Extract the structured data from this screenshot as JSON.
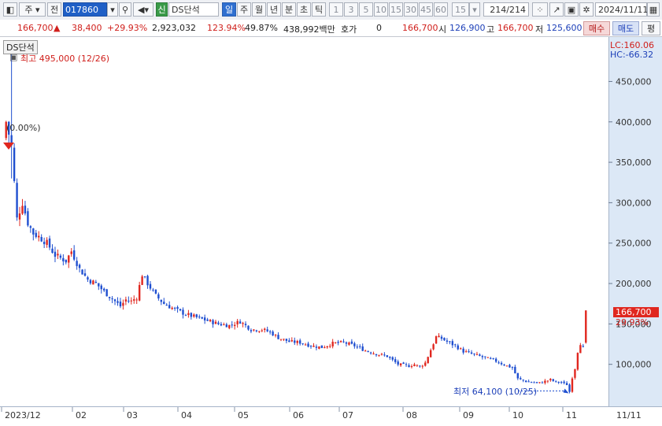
{
  "toolbar": {
    "period_prefix": "주",
    "prev_label": "전",
    "code": "017860",
    "badge": "신",
    "name": "DS단석",
    "periods": [
      "일",
      "주",
      "월",
      "년",
      "분",
      "초",
      "틱"
    ],
    "active_period": "일",
    "numbers": [
      "1",
      "3",
      "5",
      "10",
      "15",
      "30",
      "45",
      "60"
    ],
    "combo": "15",
    "count": "214",
    "count_total": "/214",
    "date": "2024/11/11"
  },
  "quote": {
    "price": "166,700",
    "change": "38,400",
    "change_pct": "+29.93%",
    "volume": "2,923,032",
    "vol_ratio": "123.94%",
    "rate2": "49.87%",
    "amount": "438,992백만",
    "hoga_label": "호가",
    "hoga_value": "0",
    "hoga_price": "166,700",
    "open_label": "시",
    "open": "126,900",
    "high_label": "고",
    "high": "166,700",
    "low_label": "저",
    "low": "125,600",
    "buy": "매수",
    "sell": "매도",
    "avg": "평"
  },
  "chart_labels": {
    "series_tag": "DS단석",
    "lc": "LC:160.06",
    "hc": "HC:-66.32",
    "start_marker": "(0.00%)",
    "max_note": "최고 495,000 (12/26)",
    "min_note": "최저 64,100 (10/25)",
    "last_price": "166,700",
    "last_pct": "29.93%"
  },
  "colors": {
    "up": "#e0271f",
    "down": "#1f4fd0",
    "panel": "#dce8f6"
  },
  "chart_data": {
    "type": "candlestick",
    "x_labels": [
      "2023/12",
      "02",
      "03",
      "04",
      "05",
      "06",
      "07",
      "08",
      "09",
      "10",
      "11",
      "11/11"
    ],
    "y_ticks": [
      100000,
      150000,
      200000,
      250000,
      300000,
      350000,
      400000,
      450000
    ],
    "y_tick_labels": [
      "100,000",
      "150,000",
      "200,000",
      "250,000",
      "300,000",
      "350,000",
      "400,000",
      "450,000"
    ],
    "ylim": [
      50000,
      505000
    ],
    "close_path": [
      [
        0,
        400000
      ],
      [
        2,
        370000
      ],
      [
        4,
        280000
      ],
      [
        6,
        300000
      ],
      [
        8,
        275000
      ],
      [
        10,
        262000
      ],
      [
        12,
        258000
      ],
      [
        15,
        250000
      ],
      [
        18,
        235000
      ],
      [
        22,
        228000
      ],
      [
        24,
        240000
      ],
      [
        27,
        218000
      ],
      [
        30,
        205000
      ],
      [
        33,
        200000
      ],
      [
        36,
        190000
      ],
      [
        40,
        178000
      ],
      [
        42,
        172000
      ],
      [
        44,
        180000
      ],
      [
        46,
        178000
      ],
      [
        48,
        183000
      ],
      [
        50,
        211000
      ],
      [
        52,
        200000
      ],
      [
        55,
        185000
      ],
      [
        58,
        175000
      ],
      [
        62,
        168000
      ],
      [
        66,
        162000
      ],
      [
        70,
        158000
      ],
      [
        74,
        154000
      ],
      [
        78,
        150000
      ],
      [
        82,
        148000
      ],
      [
        86,
        153000
      ],
      [
        88,
        148000
      ],
      [
        90,
        143000
      ],
      [
        94,
        143000
      ],
      [
        97,
        140000
      ],
      [
        100,
        133000
      ],
      [
        104,
        128000
      ],
      [
        108,
        127000
      ],
      [
        112,
        123000
      ],
      [
        116,
        121000
      ],
      [
        120,
        126000
      ],
      [
        124,
        127000
      ],
      [
        128,
        123000
      ],
      [
        132,
        117000
      ],
      [
        136,
        113000
      ],
      [
        140,
        110000
      ],
      [
        144,
        100000
      ],
      [
        148,
        98000
      ],
      [
        150,
        100000
      ],
      [
        152,
        97000
      ],
      [
        154,
        102000
      ],
      [
        156,
        118000
      ],
      [
        158,
        134000
      ],
      [
        160,
        132000
      ],
      [
        162,
        128000
      ],
      [
        165,
        123000
      ],
      [
        168,
        116000
      ],
      [
        172,
        112000
      ],
      [
        176,
        108000
      ],
      [
        180,
        104000
      ],
      [
        184,
        98000
      ],
      [
        186,
        96000
      ],
      [
        188,
        82000
      ],
      [
        192,
        78000
      ],
      [
        196,
        77000
      ],
      [
        198,
        79000
      ],
      [
        200,
        81000
      ],
      [
        202,
        78000
      ],
      [
        204,
        78000
      ],
      [
        205,
        76000
      ],
      [
        206,
        75000
      ],
      [
        207,
        66000
      ],
      [
        208,
        84000
      ],
      [
        209,
        95000
      ],
      [
        210,
        116000
      ],
      [
        211,
        126000
      ],
      [
        212,
        120000
      ],
      [
        213,
        166700
      ]
    ],
    "n_sessions": 214,
    "max": {
      "value": 495000,
      "date": "12/26"
    },
    "min": {
      "value": 64100,
      "date": "10/25"
    },
    "last": {
      "close": 166700,
      "open": 126900,
      "high": 166700,
      "low": 125600
    }
  }
}
